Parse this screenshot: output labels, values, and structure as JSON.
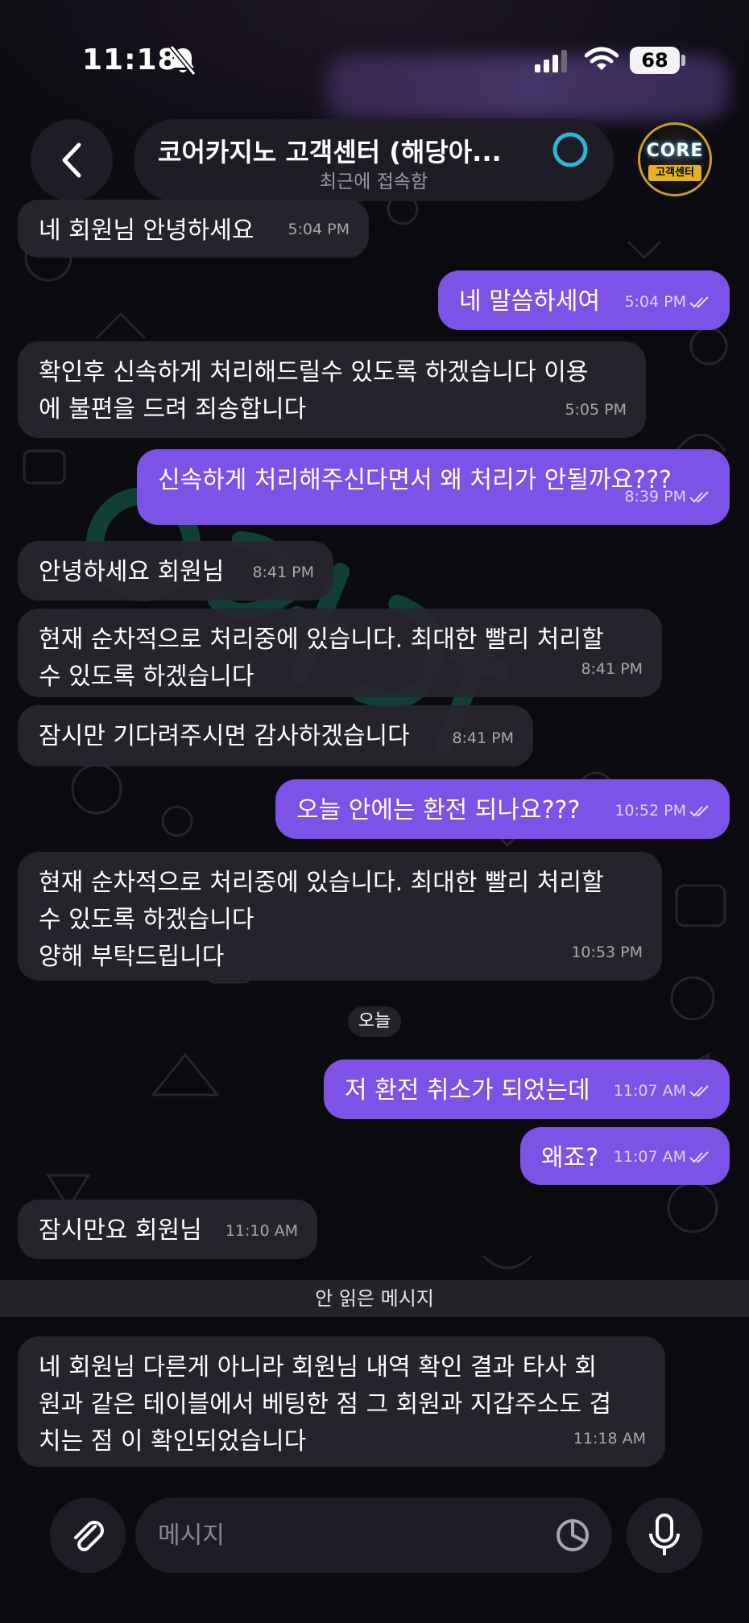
{
  "status_bar": {
    "time": "11:18",
    "battery": "68"
  },
  "header": {
    "title": "코어카지노 고객센터 (해당아...",
    "subtitle": "최근에 접속함",
    "avatar_logo": "CORE",
    "avatar_sub": "고객센터"
  },
  "messages": [
    {
      "dir": "in",
      "text": "네 회원님 안녕하세요",
      "time": "5:04 PM"
    },
    {
      "dir": "out",
      "text": "네 말씀하세여",
      "time": "5:04 PM"
    },
    {
      "dir": "in",
      "text": "확인후 신속하게 처리해드릴수 있도록 하겠습니다 이용\n에 불편을 드려 죄송합니다",
      "time": "5:05 PM"
    },
    {
      "dir": "out",
      "text": "신속하게 처리해주신다면서 왜 처리가 안될까요???",
      "time": "8:39 PM"
    },
    {
      "dir": "in",
      "text": "안녕하세요 회원님",
      "time": "8:41 PM"
    },
    {
      "dir": "in",
      "text": "현재 순차적으로 처리중에 있습니다. 최대한 빨리 처리할\n수 있도록 하겠습니다",
      "time": "8:41 PM"
    },
    {
      "dir": "in",
      "text": "잠시만 기다려주시면 감사하겠습니다",
      "time": "8:41 PM"
    },
    {
      "dir": "out",
      "text": "오늘 안에는 환전 되나요???",
      "time": "10:52 PM"
    },
    {
      "dir": "in",
      "text": "현재 순차적으로 처리중에 있습니다. 최대한 빨리 처리할\n수 있도록 하겠습니다\n양해 부탁드립니다",
      "time": "10:53 PM"
    },
    {
      "dir": "out",
      "text": "저 환전 취소가 되었는데",
      "time": "11:07 AM"
    },
    {
      "dir": "out",
      "text": "왜죠?",
      "time": "11:07 AM"
    },
    {
      "dir": "in",
      "text": "잠시만요 회원님",
      "time": "11:10 AM"
    },
    {
      "dir": "in",
      "text": "네 회원님 다른게 아니라 회원님 내역 확인 결과 타사 회\n원과 같은 테이블에서 베팅한 점 그 회원과 지갑주소도 겹\n치는 점 이 확인되었습니다",
      "time": "11:18 AM"
    }
  ],
  "date_separator": "오늘",
  "unread_banner": "안 읽은 메시지",
  "composer": {
    "placeholder": "메시지"
  },
  "colors": {
    "outgoing": "#7d52e6",
    "incoming": "#28262e",
    "background": "#0b0a0f"
  }
}
